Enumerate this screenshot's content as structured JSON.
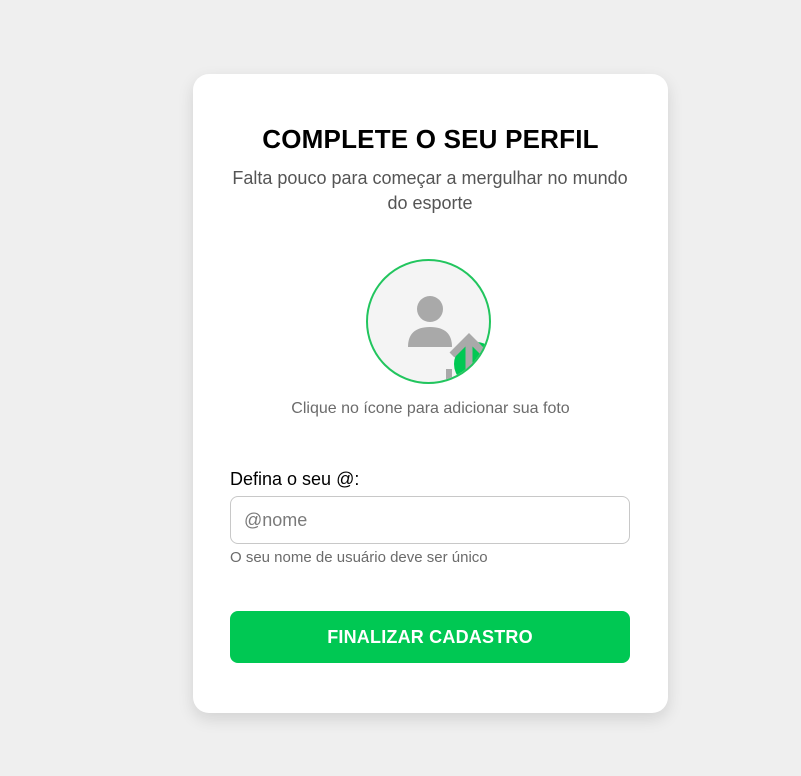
{
  "profile_form": {
    "title": "COMPLETE O SEU PERFIL",
    "subtitle": "Falta pouco para começar a mergulhar no mundo do esporte",
    "photo_hint": "Clique no ícone para adicionar sua foto",
    "username_label": "Defina o seu @:",
    "username_placeholder": "@nome",
    "username_value": "",
    "username_help": "O seu nome de usuário deve ser único",
    "submit_label": "FINALIZAR CADASTRO"
  },
  "icons": {
    "avatar": "user-silhouette-icon",
    "upload": "upload-arrow-icon"
  },
  "colors": {
    "page_background": "#efefef",
    "card_background": "#ffffff",
    "accent_green": "#00c853",
    "avatar_border": "#22c55e",
    "silhouette_gray": "#a9a9a9"
  }
}
